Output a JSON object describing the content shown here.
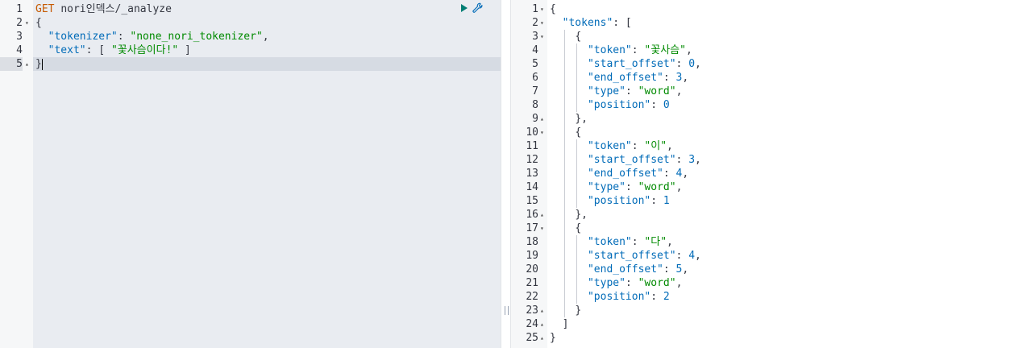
{
  "request_editor": {
    "method": "GET",
    "path": "nori인덱스/_analyze",
    "lines": [
      {
        "n": "1",
        "text": ""
      },
      {
        "n": "2",
        "fold": "▾",
        "text": "{"
      },
      {
        "n": "3",
        "text": ""
      },
      {
        "n": "4",
        "text": ""
      },
      {
        "n": "5",
        "fold": "▴",
        "text": "}"
      }
    ],
    "tokenizer_key": "\"tokenizer\"",
    "tokenizer_value": "\"none_nori_tokenizer\"",
    "text_key": "\"text\"",
    "text_value": "\"꽃사슴이다!\""
  },
  "actions": {
    "run_icon": "play-icon",
    "settings_icon": "wrench-icon"
  },
  "response_viewer": {
    "line_numbers": [
      "1",
      "2",
      "3",
      "4",
      "5",
      "6",
      "7",
      "8",
      "9",
      "10",
      "11",
      "12",
      "13",
      "14",
      "15",
      "16",
      "17",
      "18",
      "19",
      "20",
      "21",
      "22",
      "23",
      "24",
      "25"
    ],
    "tokens_key": "\"tokens\"",
    "tokens": [
      {
        "token": "\"꽃사슴\"",
        "start_offset": "0",
        "end_offset": "3",
        "type": "\"word\"",
        "position": "0"
      },
      {
        "token": "\"이\"",
        "start_offset": "3",
        "end_offset": "4",
        "type": "\"word\"",
        "position": "1"
      },
      {
        "token": "\"다\"",
        "start_offset": "4",
        "end_offset": "5",
        "type": "\"word\"",
        "position": "2"
      }
    ],
    "keys": {
      "token": "\"token\"",
      "start_offset": "\"start_offset\"",
      "end_offset": "\"end_offset\"",
      "type": "\"type\"",
      "position": "\"position\""
    }
  },
  "colors": {
    "method": "#c65a00",
    "key": "#006bb8",
    "string": "#008a00",
    "run": "#017d73"
  }
}
